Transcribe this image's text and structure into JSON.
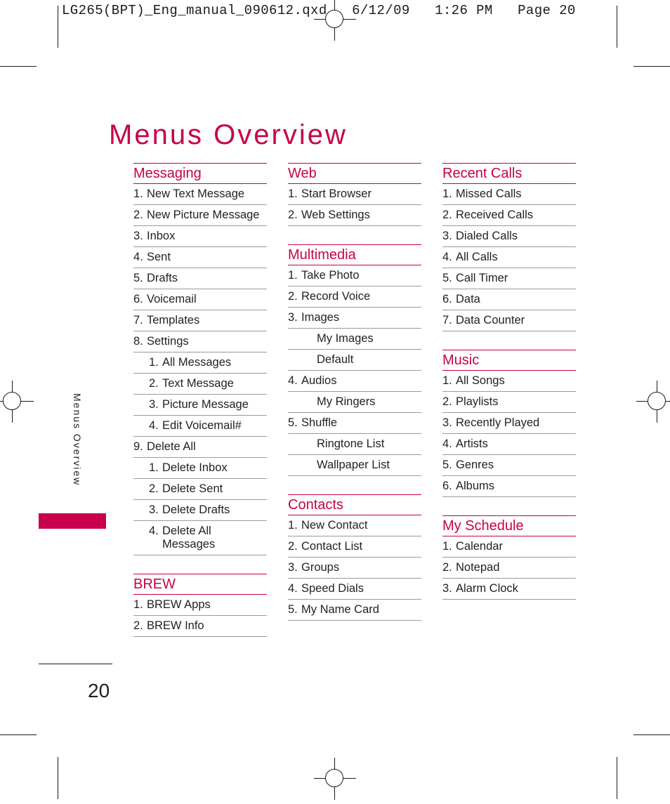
{
  "slug": "LG265(BPT)_Eng_manual_090612.qxd   6/12/09   1:26 PM   Page 20",
  "page": {
    "title": "Menus Overview",
    "side_label": "Menus Overview",
    "number": "20",
    "accent_color": "#c8004b",
    "text_color": "#231f20",
    "rule_color": "#9a9a9a"
  },
  "columns": [
    {
      "sections": [
        {
          "title": "Messaging",
          "items": [
            {
              "num": "1.",
              "text": "New Text Message",
              "level": 0
            },
            {
              "num": "2.",
              "text": "New Picture Message",
              "level": 0
            },
            {
              "num": "3.",
              "text": "Inbox",
              "level": 0
            },
            {
              "num": "4.",
              "text": "Sent",
              "level": 0
            },
            {
              "num": "5.",
              "text": "Drafts",
              "level": 0
            },
            {
              "num": "6.",
              "text": "Voicemail",
              "level": 0
            },
            {
              "num": "7.",
              "text": "Templates",
              "level": 0
            },
            {
              "num": "8.",
              "text": "Settings",
              "level": 0
            },
            {
              "num": "1.",
              "text": "All Messages",
              "level": 1
            },
            {
              "num": "2.",
              "text": "Text Message",
              "level": 1
            },
            {
              "num": "3.",
              "text": "Picture Message",
              "level": 1
            },
            {
              "num": "4.",
              "text": "Edit Voicemail#",
              "level": 1
            },
            {
              "num": "9.",
              "text": "Delete All",
              "level": 0
            },
            {
              "num": "1.",
              "text": "Delete Inbox",
              "level": 1
            },
            {
              "num": "2.",
              "text": "Delete Sent",
              "level": 1
            },
            {
              "num": "3.",
              "text": "Delete Drafts",
              "level": 1
            },
            {
              "num": "4.",
              "text": "Delete All Messages",
              "level": 1
            }
          ]
        },
        {
          "title": "BREW",
          "items": [
            {
              "num": "1.",
              "text": "BREW Apps",
              "level": 0
            },
            {
              "num": "2.",
              "text": "BREW Info",
              "level": 0
            }
          ]
        }
      ]
    },
    {
      "sections": [
        {
          "title": "Web",
          "items": [
            {
              "num": "1.",
              "text": "Start Browser",
              "level": 0
            },
            {
              "num": "2.",
              "text": "Web Settings",
              "level": 0
            }
          ]
        },
        {
          "title": "Multimedia",
          "items": [
            {
              "num": "1.",
              "text": "Take Photo",
              "level": 0
            },
            {
              "num": "2.",
              "text": "Record Voice",
              "level": 0
            },
            {
              "num": "3.",
              "text": "Images",
              "level": 0
            },
            {
              "num": "",
              "text": "My Images",
              "level": 1
            },
            {
              "num": "",
              "text": "Default",
              "level": 1
            },
            {
              "num": "4.",
              "text": "Audios",
              "level": 0
            },
            {
              "num": "",
              "text": "My Ringers",
              "level": 1
            },
            {
              "num": "5.",
              "text": "Shuffle",
              "level": 0
            },
            {
              "num": "",
              "text": "Ringtone List",
              "level": 1
            },
            {
              "num": "",
              "text": "Wallpaper List",
              "level": 1
            }
          ]
        },
        {
          "title": "Contacts",
          "items": [
            {
              "num": "1.",
              "text": "New Contact",
              "level": 0
            },
            {
              "num": "2.",
              "text": "Contact List",
              "level": 0
            },
            {
              "num": "3.",
              "text": "Groups",
              "level": 0
            },
            {
              "num": "4.",
              "text": "Speed Dials",
              "level": 0
            },
            {
              "num": "5.",
              "text": "My Name Card",
              "level": 0
            }
          ]
        }
      ]
    },
    {
      "sections": [
        {
          "title": "Recent Calls",
          "items": [
            {
              "num": "1.",
              "text": "Missed Calls",
              "level": 0
            },
            {
              "num": "2.",
              "text": "Received Calls",
              "level": 0
            },
            {
              "num": "3.",
              "text": "Dialed Calls",
              "level": 0
            },
            {
              "num": "4.",
              "text": "All Calls",
              "level": 0
            },
            {
              "num": "5.",
              "text": "Call Timer",
              "level": 0
            },
            {
              "num": "6.",
              "text": "Data",
              "level": 0
            },
            {
              "num": "7.",
              "text": "Data Counter",
              "level": 0
            }
          ]
        },
        {
          "title": "Music",
          "items": [
            {
              "num": "1.",
              "text": "All Songs",
              "level": 0
            },
            {
              "num": "2.",
              "text": "Playlists",
              "level": 0
            },
            {
              "num": "3.",
              "text": "Recently Played",
              "level": 0
            },
            {
              "num": "4.",
              "text": "Artists",
              "level": 0
            },
            {
              "num": "5.",
              "text": "Genres",
              "level": 0
            },
            {
              "num": "6.",
              "text": "Albums",
              "level": 0
            }
          ]
        },
        {
          "title": "My Schedule",
          "items": [
            {
              "num": "1.",
              "text": "Calendar",
              "level": 0
            },
            {
              "num": "2.",
              "text": "Notepad",
              "level": 0
            },
            {
              "num": "3.",
              "text": "Alarm Clock",
              "level": 0
            }
          ]
        }
      ]
    }
  ]
}
